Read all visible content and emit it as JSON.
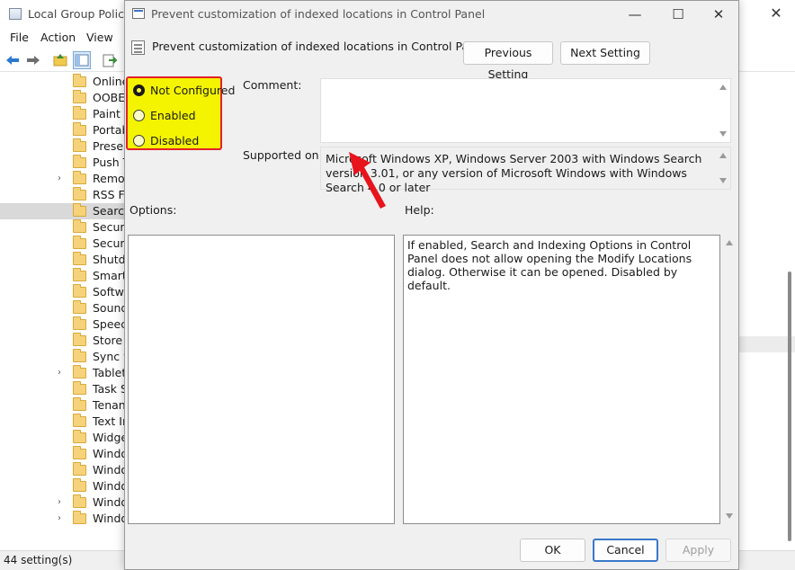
{
  "background_window": {
    "title": "Local Group Policy E",
    "close_glyph": "✕",
    "menu": [
      "File",
      "Action",
      "View"
    ],
    "tree_items": [
      {
        "label": "Online",
        "expandable": false,
        "selected": false
      },
      {
        "label": "OOBE",
        "expandable": false,
        "selected": false
      },
      {
        "label": "Paint",
        "expandable": false,
        "selected": false
      },
      {
        "label": "Portab",
        "expandable": false,
        "selected": false
      },
      {
        "label": "Presen",
        "expandable": false,
        "selected": false
      },
      {
        "label": "Push T",
        "expandable": false,
        "selected": false
      },
      {
        "label": "Remot",
        "expandable": true,
        "selected": false
      },
      {
        "label": "RSS Fe",
        "expandable": false,
        "selected": false
      },
      {
        "label": "Search",
        "expandable": false,
        "selected": true
      },
      {
        "label": "Secure",
        "expandable": false,
        "selected": false
      },
      {
        "label": "Securit",
        "expandable": false,
        "selected": false
      },
      {
        "label": "Shutdo",
        "expandable": false,
        "selected": false
      },
      {
        "label": "Smart",
        "expandable": false,
        "selected": false
      },
      {
        "label": "Softwa",
        "expandable": false,
        "selected": false
      },
      {
        "label": "Sound",
        "expandable": false,
        "selected": false
      },
      {
        "label": "Speech",
        "expandable": false,
        "selected": false
      },
      {
        "label": "Store",
        "expandable": false,
        "selected": false
      },
      {
        "label": "Sync y",
        "expandable": false,
        "selected": false
      },
      {
        "label": "Tablet",
        "expandable": true,
        "selected": false
      },
      {
        "label": "Task Sc",
        "expandable": false,
        "selected": false
      },
      {
        "label": "Tenant",
        "expandable": false,
        "selected": false
      },
      {
        "label": "Text In",
        "expandable": false,
        "selected": false
      },
      {
        "label": "Widge",
        "expandable": false,
        "selected": false
      },
      {
        "label": "Windo",
        "expandable": false,
        "selected": false
      },
      {
        "label": "Windo",
        "expandable": false,
        "selected": false
      },
      {
        "label": "Windo",
        "expandable": false,
        "selected": false
      },
      {
        "label": "Windo",
        "expandable": true,
        "selected": false
      },
      {
        "label": "Windo",
        "expandable": true,
        "selected": false
      }
    ],
    "status": "44 setting(s)"
  },
  "dialog": {
    "title": "Prevent customization of indexed locations in Control Panel",
    "policy_name": "Prevent customization of indexed locations in Control Panel",
    "controls": {
      "minimize": "—",
      "maximize": "☐",
      "close": "✕"
    },
    "previous_setting": "Previous Setting",
    "next_setting": "Next Setting",
    "states": [
      {
        "label": "Not Configured",
        "checked": true
      },
      {
        "label": "Enabled",
        "checked": false
      },
      {
        "label": "Disabled",
        "checked": false
      }
    ],
    "comment_label": "Comment:",
    "comment_value": "",
    "supported_label": "Supported on:",
    "supported_text": "Microsoft Windows XP, Windows Server 2003 with Windows Search version 3.01, or any version of Microsoft Windows with Windows Search 4.0 or later",
    "options_label": "Options:",
    "help_label": "Help:",
    "help_text": "If enabled, Search and Indexing Options in Control Panel does not allow opening the Modify Locations dialog. Otherwise it can be opened. Disabled by default.",
    "ok": "OK",
    "cancel": "Cancel",
    "apply": "Apply"
  },
  "colors": {
    "highlight_fill": "#f4f400",
    "highlight_border": "#e2202a",
    "arrow": "#e8141c",
    "default_button_border": "#3a78c9"
  },
  "icons": [
    "app-icon",
    "back-arrow-icon",
    "forward-arrow-icon",
    "folder-up-icon",
    "show-hide-tree-icon",
    "export-icon",
    "folder-icon",
    "policy-setting-icon",
    "radio-button"
  ]
}
